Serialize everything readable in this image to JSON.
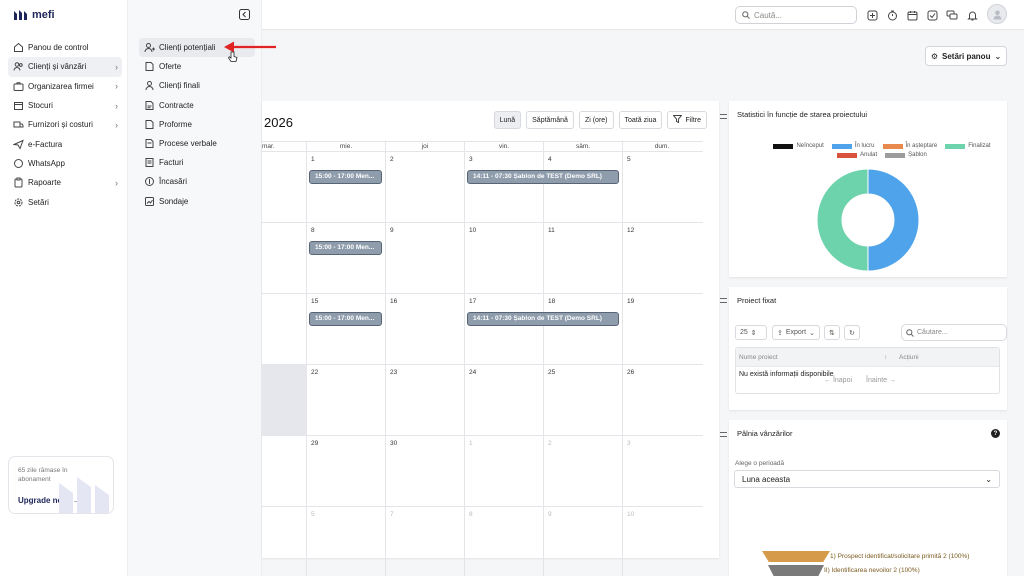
{
  "app": {
    "logo_text": "mefi"
  },
  "topbar": {
    "search_placeholder": "Caută..."
  },
  "sidebar": {
    "items": [
      {
        "label": "Panou de control",
        "icon": "home-icon"
      },
      {
        "label": "Clienți și vânzări",
        "icon": "users-icon",
        "active": true
      },
      {
        "label": "Organizarea firmei",
        "icon": "briefcase-icon"
      },
      {
        "label": "Stocuri",
        "icon": "box-icon"
      },
      {
        "label": "Furnizori și costuri",
        "icon": "truck-icon"
      },
      {
        "label": "e-Factura",
        "icon": "send-icon"
      },
      {
        "label": "WhatsApp",
        "icon": "whatsapp-icon"
      },
      {
        "label": "Rapoarte",
        "icon": "clipboard-icon"
      },
      {
        "label": "Setări",
        "icon": "gear-icon"
      }
    ],
    "upgrade": {
      "text": "65 zile rămase în abonament",
      "button": "Upgrade now"
    }
  },
  "submenu": {
    "items": [
      {
        "label": "Clienți potențiali",
        "active": true
      },
      {
        "label": "Oferte"
      },
      {
        "label": "Clienți finali"
      },
      {
        "label": "Contracte"
      },
      {
        "label": "Proforme"
      },
      {
        "label": "Procese verbale"
      },
      {
        "label": "Facturi"
      },
      {
        "label": "Încasări"
      },
      {
        "label": "Sondaje"
      }
    ]
  },
  "panel_settings": {
    "label": "Setări panou"
  },
  "calendar": {
    "title": "2026",
    "views": [
      "Lună",
      "Săptămână",
      "Zi (ore)",
      "Toată ziua",
      "Filtre"
    ],
    "weekdays": [
      "mar.",
      "mie.",
      "joi",
      "vin.",
      "sâm.",
      "dum."
    ],
    "weeks": [
      [
        "",
        "1",
        "2",
        "3",
        "4",
        "5"
      ],
      [
        "",
        "8",
        "9",
        "10",
        "11",
        "12"
      ],
      [
        "",
        "15",
        "16",
        "17",
        "18",
        "19"
      ],
      [
        "",
        "22",
        "23",
        "24",
        "25",
        "26"
      ],
      [
        "",
        "29",
        "30",
        "1",
        "2",
        "3"
      ],
      [
        "",
        "5",
        "7",
        "8",
        "9",
        "10"
      ]
    ],
    "events": {
      "meeting": "15:00 - 17:00 Men...",
      "template": "14:11 - 07:30 Șablon de TEST (Demo SRL)"
    }
  },
  "status_chart": {
    "title": "Statistici în funcție de starea proiectului",
    "chart_data": {
      "type": "pie",
      "categories": [
        "Neînceput",
        "În lucru",
        "În așteptare",
        "Finalizat",
        "Anulat",
        "Șablon"
      ],
      "colors": [
        "#111111",
        "#4ea3ea",
        "#e8894e",
        "#6dd3ad",
        "#d9533c",
        "#9c9c9c"
      ],
      "values": [
        0,
        50,
        0,
        50,
        0,
        0
      ]
    }
  },
  "pinned_project": {
    "title": "Proiect fixat",
    "page_size": "25",
    "export_label": "Export",
    "search_placeholder": "Căutare...",
    "columns": [
      "Nume proiect",
      "Acțiuni"
    ],
    "empty_text": "Nu există informații disponibile",
    "prev": "Înapoi",
    "next": "Înainte"
  },
  "sales_funnel": {
    "title": "Pâlnia vânzărilor",
    "period_label": "Alege o perioadă",
    "period_value": "Luna aceasta",
    "stages": [
      {
        "label": "1) Prospect identificat/solicitare primită 2 (100%)",
        "color": "#d59b4a"
      },
      {
        "label": "II) Identificarea nevoilor 2 (100%)",
        "color": "#7a7a7a"
      }
    ]
  }
}
